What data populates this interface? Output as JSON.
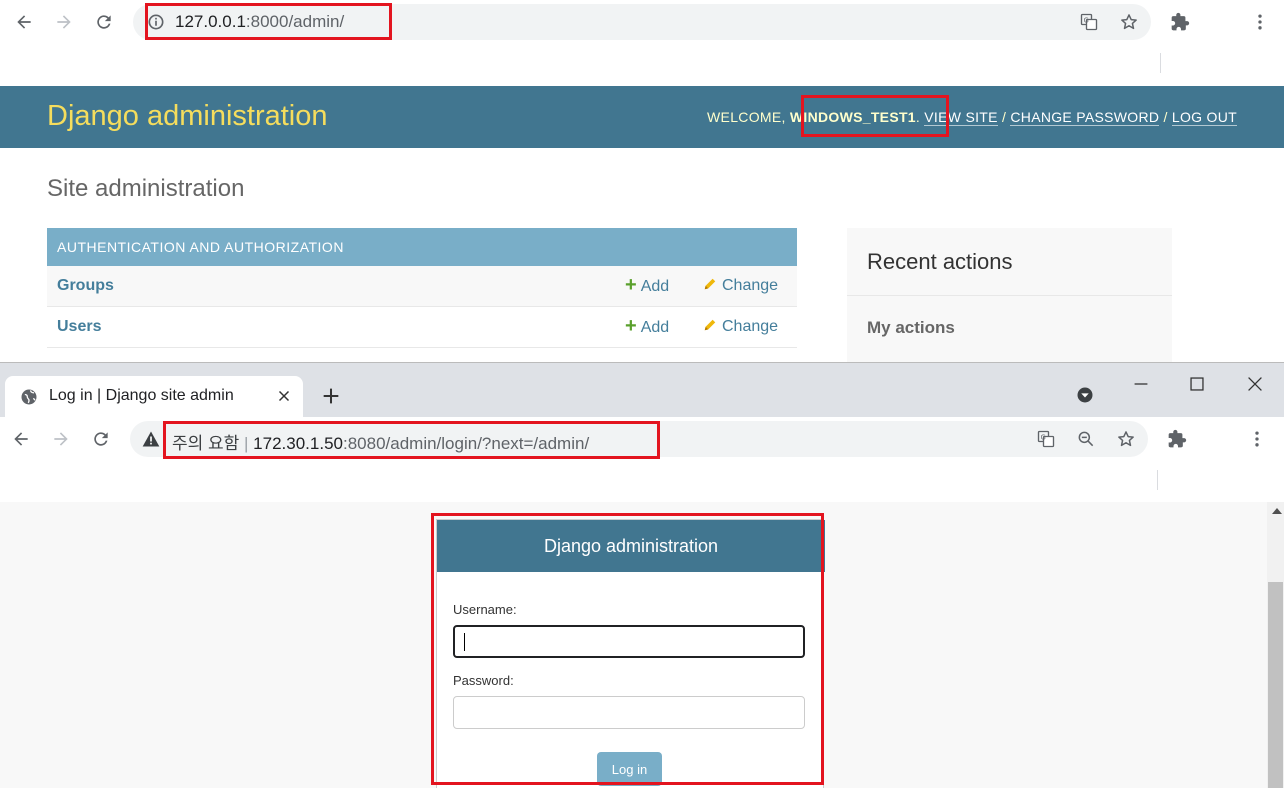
{
  "browser_top": {
    "url_host": "127.0.0.1",
    "url_rest": ":8000/admin/"
  },
  "django_admin": {
    "brand": "Django administration",
    "welcome": "WELCOME, ",
    "username": "WINDOWS_TEST1",
    "welcome_suffix": ". ",
    "view_site": "VIEW SITE",
    "change_password": "CHANGE PASSWORD",
    "log_out": "LOG OUT",
    "sep": " / ",
    "site_title": "Site administration",
    "module_caption": "AUTHENTICATION AND AUTHORIZATION",
    "models": [
      {
        "name": "Groups",
        "add": "Add",
        "change": "Change"
      },
      {
        "name": "Users",
        "add": "Add",
        "change": "Change"
      }
    ],
    "recent_actions": "Recent actions",
    "my_actions": "My actions"
  },
  "browser_bottom": {
    "tab_title": "Log in | Django site admin",
    "security_label": "주의 요함",
    "url_host": "172.30.1.50",
    "url_rest": ":8080/admin/login/?next=/admin/"
  },
  "login": {
    "header": "Django administration",
    "username_label": "Username:",
    "password_label": "Password:",
    "submit": "Log in"
  },
  "colors": {
    "header_bg": "#417690",
    "brand_yellow": "#f5dd5d",
    "module_caption_bg": "#79aec8",
    "highlight_red": "#e3141f"
  }
}
